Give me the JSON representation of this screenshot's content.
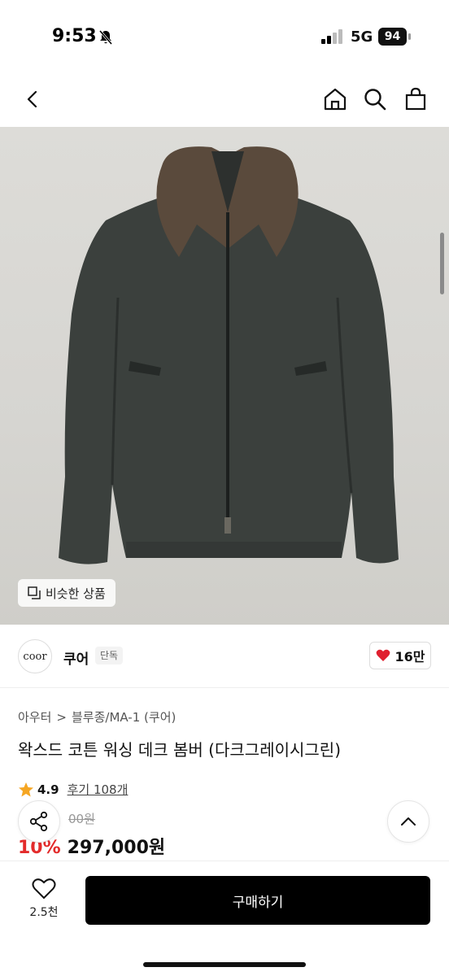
{
  "status": {
    "time": "9:53",
    "network": "5G",
    "battery": "94",
    "icons": [
      "bell-off-icon",
      "signal-icon",
      "battery-icon"
    ]
  },
  "header": {
    "icons": [
      "back-arrow-icon",
      "home-icon",
      "search-icon",
      "shopping-bag-icon"
    ]
  },
  "product_image": {
    "similar_label": "비슷한 상품"
  },
  "brand": {
    "logo_text": "coor",
    "name": "쿠어",
    "badge": "단독",
    "likes": "16만"
  },
  "breadcrumb": {
    "category": "아우터",
    "separator": ">",
    "subcategory": "블루종/MA-1 (쿠어)"
  },
  "product": {
    "title": "왁스드 코튼 워싱 데크 봄버 (다크그레이시그린)",
    "rating": "4.9",
    "reviews": "후기 108개",
    "original_price": "00원",
    "discount": "10%",
    "price": "297,000원"
  },
  "bottom_bar": {
    "wish_count": "2.5천",
    "buy_label": "구매하기"
  },
  "colors": {
    "accent_red": "#e32b2b",
    "heart_red": "#e0202f",
    "star": "#f5a623",
    "buy_button": "#000000"
  }
}
